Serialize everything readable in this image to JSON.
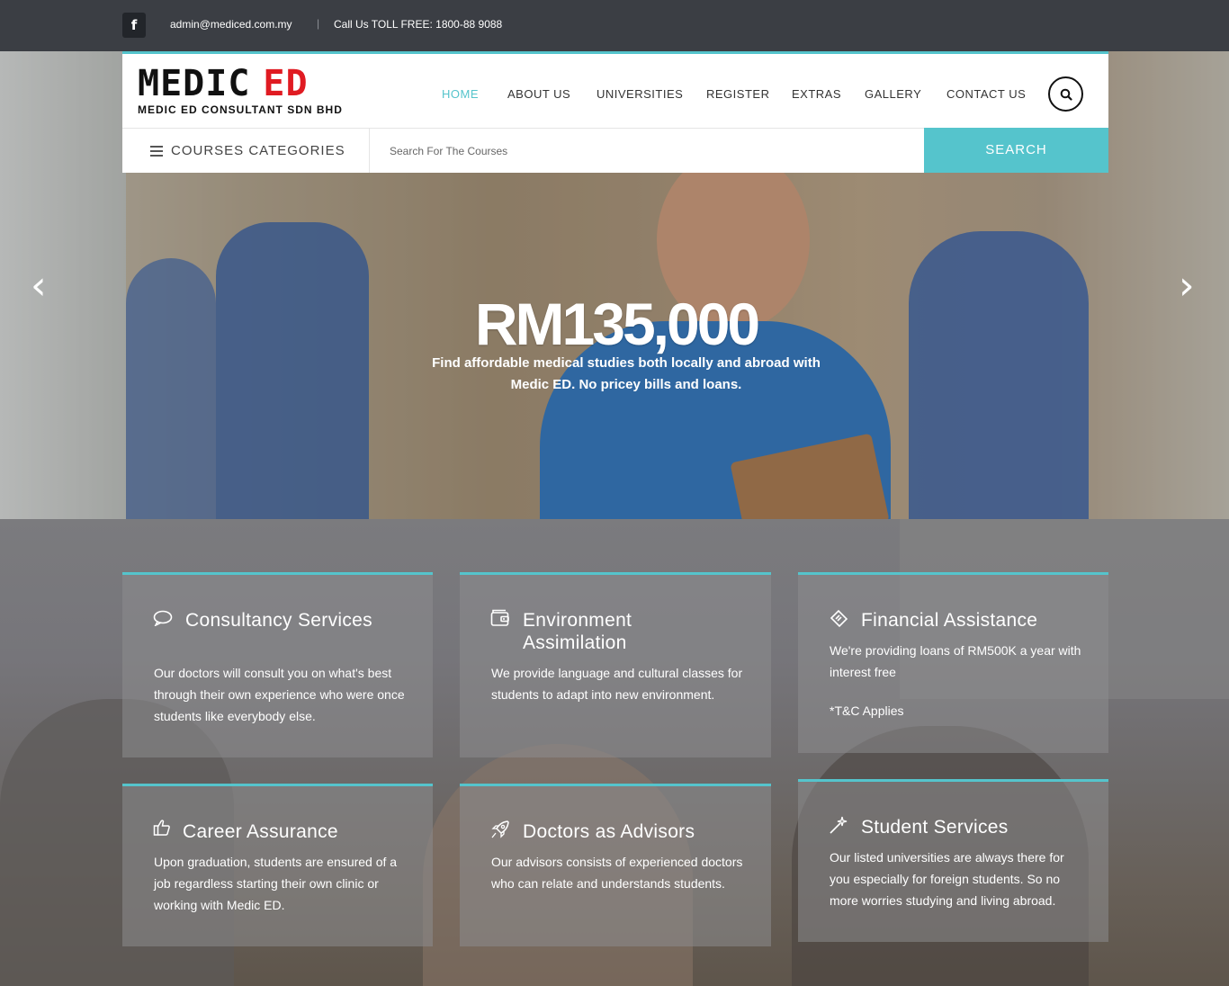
{
  "topbar": {
    "facebook_icon": "facebook-icon",
    "email": "admin@mediced.com.my",
    "separator": "|",
    "phone": "Call Us TOLL FREE: 1800-88 9088"
  },
  "brand": {
    "name_left": "MEDIC",
    "name_right": "ED",
    "tagline": "MEDIC ED CONSULTANT SDN BHD",
    "accent": "#e01b22"
  },
  "nav": {
    "items": [
      "HOME",
      "ABOUT US",
      "UNIVERSITIES",
      "REGISTER",
      "EXTRAS",
      "GALLERY",
      "CONTACT US"
    ],
    "active_index": 0,
    "search_icon": "search-icon"
  },
  "course_bar": {
    "categories_label": "COURSES CATEGORIES",
    "search_placeholder": "Search For The Courses",
    "search_button": "SEARCH",
    "accent": "#55c4cc"
  },
  "hero": {
    "title": "RM135,000",
    "subtitle": "Find affordable medical studies both locally and abroad with Medic ED. No pricey bills and loans.",
    "prev_icon": "chevron-left-icon",
    "next_icon": "chevron-right-icon"
  },
  "features": [
    {
      "icon": "chat-bubble-icon",
      "title": "Consultancy Services",
      "body": "Our doctors will consult you on what's best through their own experience who were once students like everybody else."
    },
    {
      "icon": "wallet-icon",
      "title": "Environment Assimilation",
      "body": "We provide language and cultural classes for students to adapt into new environment."
    },
    {
      "icon": "ticket-icon",
      "title": "Financial Assistance",
      "body": "We're providing loans of RM500K a year with interest free",
      "note": "*T&C Applies"
    },
    {
      "icon": "thumbs-up-icon",
      "title": "Career Assurance",
      "body": "Upon graduation, students are ensured of a job regardless starting their own clinic or working with Medic ED."
    },
    {
      "icon": "rocket-icon",
      "title": "Doctors as Advisors",
      "body": "Our advisors consists of experienced doctors who can relate and understands students."
    },
    {
      "icon": "magic-wand-icon",
      "title": "Student Services",
      "body": "Our listed universities are always there for you especially for foreign students. So no more worries studying and living abroad."
    }
  ]
}
